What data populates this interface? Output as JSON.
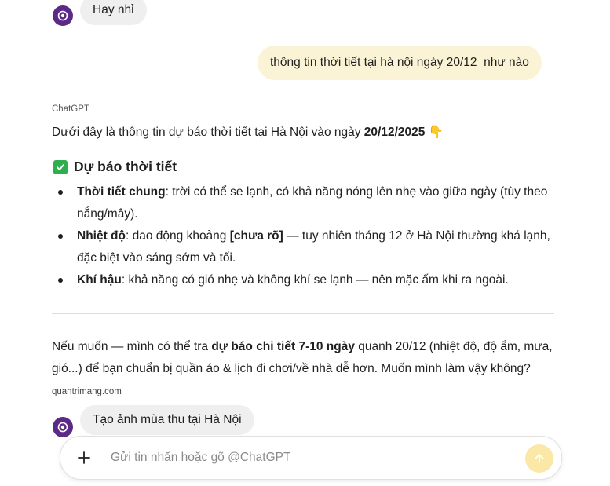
{
  "messages": {
    "first_user": {
      "text": "Hay nhỉ"
    },
    "question": {
      "text": "thông tin thời tiết tại hà nội ngày 20/12  như nào"
    },
    "assistant": {
      "sender": "ChatGPT",
      "intro_prefix": "Dưới đây là thông tin dự báo thời tiết tại Hà Nội vào ngày ",
      "intro_date": "20/12/2025",
      "intro_emoji": "👇",
      "section_title": "Dự báo thời tiết",
      "bullets": [
        {
          "label": "Thời tiết chung",
          "text": ": trời có thể se lạnh, có khả năng nóng lên nhẹ vào giữa ngày (tùy theo nắng/mây)."
        },
        {
          "label": "Nhiệt độ",
          "text_a": ": dao động khoảng ",
          "bold_mid": "[chưa rõ]",
          "text_b": " — tuy nhiên tháng 12 ở Hà Nội thường khá lạnh, đặc biệt vào sáng sớm và tối."
        },
        {
          "label": "Khí hậu",
          "text": ": khả năng có gió nhẹ và không khí se lạnh — nên mặc ấm khi ra ngoài."
        }
      ],
      "followup_prefix": "Nếu muốn — mình có thể tra ",
      "followup_bold": "dự báo chi tiết 7-10 ngày",
      "followup_suffix": " quanh 20/12 (nhiệt độ, độ ẩm, mưa, gió...) để bạn chuẩn bị quần áo & lịch đi chơi/về nhà dễ hơn. Muốn mình làm vậy không?",
      "watermark": "quantrimang.com"
    },
    "last_user": {
      "text": "Tạo ảnh mùa thu tại Hà Nội"
    }
  },
  "composer": {
    "placeholder": "Gửi tin nhắn hoặc gõ @ChatGPT",
    "value": ""
  },
  "icons": {
    "avatar": "openai-logo-icon",
    "section": "check-box-icon",
    "pointer": "pointing-down-emoji",
    "add": "plus-icon",
    "send": "arrow-up-icon"
  },
  "colors": {
    "avatar_bg": "#5b2a86",
    "user_bubble": "#efefef",
    "question_bubble": "#fbf3d5",
    "send_button": "#fbe7a6",
    "check_green": "#2fae4e"
  }
}
